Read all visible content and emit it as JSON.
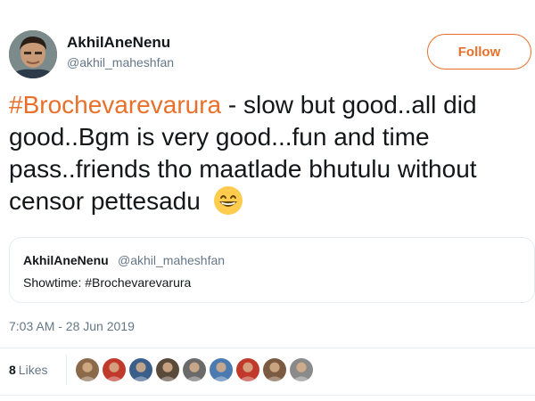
{
  "author": {
    "display_name": "AkhilAneNenu",
    "handle": "@akhil_maheshfan"
  },
  "follow_button": {
    "label": "Follow"
  },
  "tweet": {
    "hashtag": "#Brochevarevarura",
    "text": " - slow but good..all did good..Bgm is very good...fun and time pass..friends tho maatlade bhutulu without censor pettesadu",
    "emoji": "grinning-face-with-smiling-eyes-icon"
  },
  "quoted_tweet": {
    "display_name": "AkhilAneNenu",
    "handle": "@akhil_maheshfan",
    "text": "Showtime: #Brochevarevarura"
  },
  "timestamp": "7:03 AM - 28 Jun 2019",
  "likes": {
    "count": "8",
    "label": "Likes",
    "avatar_colors": [
      "#8a6a4a",
      "#c0392b",
      "#3a5f8a",
      "#5a4a3a",
      "#6a6a6a",
      "#4a7ab0",
      "#c0392b",
      "#7a5a40",
      "#8a8a8a"
    ]
  },
  "colors": {
    "accent": "#e8702a",
    "text": "#14171a",
    "muted": "#657786",
    "border": "#e6ecf0"
  }
}
